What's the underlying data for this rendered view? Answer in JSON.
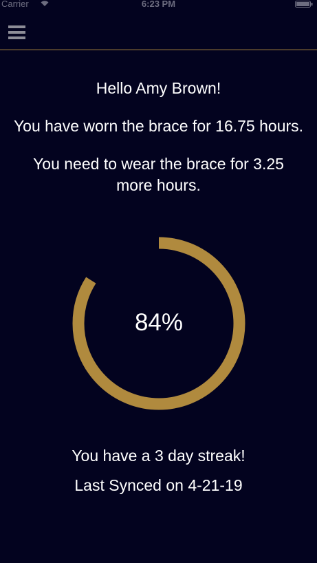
{
  "status_bar": {
    "carrier": "Carrier",
    "time": "6:23 PM"
  },
  "nav": {
    "menu_icon": "hamburger-menu-icon"
  },
  "colors": {
    "background": "#03031f",
    "accent": "#b08a3e",
    "text": "#ffffff",
    "menu_icon": "#8d8d97"
  },
  "main": {
    "greeting": "Hello Amy Brown!",
    "worn_message": "You have worn the brace for 16.75 hours.",
    "remaining_message": "You need to wear the brace for 3.25 more hours.",
    "progress": {
      "percent_label": "84%",
      "value": 0.84
    },
    "streak_message": "You have a 3 day streak!",
    "last_synced": "Last Synced on 4-21-19"
  }
}
